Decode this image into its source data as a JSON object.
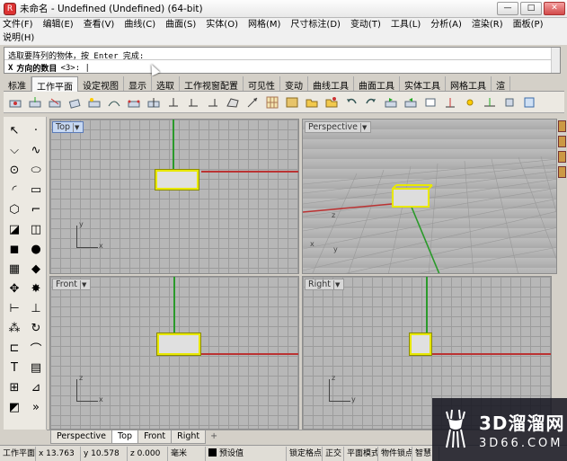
{
  "window": {
    "title": "未命名 - Undefined (Undefined) (64-bit)",
    "minimize": "—",
    "maximize": "□",
    "close": "✕"
  },
  "menu": {
    "row1": [
      "文件(F)",
      "编辑(E)",
      "查看(V)",
      "曲线(C)",
      "曲面(S)",
      "实体(O)",
      "网格(M)",
      "尺寸标注(D)",
      "变动(T)",
      "工具(L)",
      "分析(A)",
      "渲染(R)",
      "面板(P)"
    ],
    "row2": [
      "说明(H)"
    ]
  },
  "command": {
    "history": "选取要阵列的物体，按 Enter 完成:",
    "prefix": "X",
    "prompt": "方向的数目",
    "option": "<3>: |"
  },
  "toolbar_tabs": [
    "标准",
    "工作平面",
    "设定视图",
    "显示",
    "选取",
    "工作视窗配置",
    "可见性",
    "变动",
    "曲线工具",
    "曲面工具",
    "实体工具",
    "网格工具",
    "渲"
  ],
  "active_toolbar_tab": 1,
  "viewports": {
    "top": {
      "label": "Top"
    },
    "perspective": {
      "label": "Perspective"
    },
    "front": {
      "label": "Front"
    },
    "right": {
      "label": "Right"
    }
  },
  "axis_letters": {
    "x": "x",
    "y": "y",
    "z": "z"
  },
  "view_tabs": [
    "Perspective",
    "Top",
    "Front",
    "Right"
  ],
  "active_view_tab": 1,
  "view_tab_add": "+",
  "status": {
    "cplane": "工作平面",
    "x": "x 13.763",
    "y": "y 10.578",
    "z": "z 0.000",
    "units": "毫米",
    "layer": "预设值",
    "snap": "锁定格点",
    "ortho": "正交",
    "planar": "平面模式",
    "osnap": "物件锁点",
    "smarttrack": "智慧"
  },
  "watermark": {
    "big": "3D溜溜网",
    "small": "3D66.COM"
  },
  "colors": {
    "x_axis": "#b33333",
    "y_axis": "#2a9a2a",
    "selection": "#e8e800"
  }
}
